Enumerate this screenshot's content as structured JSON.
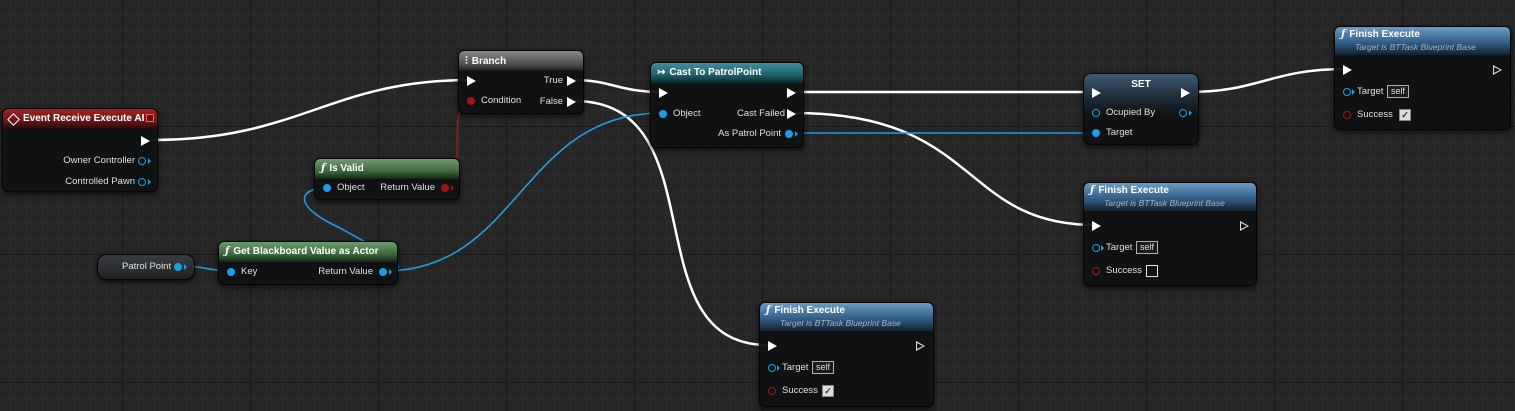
{
  "graph": {
    "event_node": {
      "title": "Event Receive Execute AI",
      "pins": {
        "owner_controller": "Owner Controller",
        "controlled_pawn": "Controlled Pawn"
      }
    },
    "branch_node": {
      "title": "Branch",
      "icon": "branch-icon",
      "pins": {
        "true": "True",
        "false": "False",
        "condition": "Condition"
      }
    },
    "is_valid_node": {
      "title": "Is Valid",
      "pins": {
        "object": "Object",
        "return_value": "Return Value"
      }
    },
    "get_blackboard_node": {
      "title": "Get Blackboard Value as Actor",
      "pins": {
        "key": "Key",
        "return_value": "Return Value"
      }
    },
    "patrol_point_var": {
      "label": "Patrol Point"
    },
    "cast_node": {
      "title": "Cast To PatrolPoint",
      "pins": {
        "object": "Object",
        "cast_failed": "Cast Failed",
        "as_patrol_point": "As Patrol Point"
      }
    },
    "set_node": {
      "title": "SET",
      "pins": {
        "ocupied_by": "Ocupied By",
        "target": "Target"
      }
    },
    "finish_execute_nodes": [
      {
        "title": "Finish Execute",
        "subtitle": "Target is BTTask Blueprint Base",
        "target_label": "Target",
        "target_value": "self",
        "success_label": "Success",
        "success_checked": true
      },
      {
        "title": "Finish Execute",
        "subtitle": "Target is BTTask Blueprint Base",
        "target_label": "Target",
        "target_value": "self",
        "success_label": "Success",
        "success_checked": false
      },
      {
        "title": "Finish Execute",
        "subtitle": "Target is BTTask Blueprint Base",
        "target_label": "Target",
        "target_value": "self",
        "success_label": "Success",
        "success_checked": true
      }
    ],
    "function_icon": "ƒ",
    "colors": {
      "exec_wire": "#ffffff",
      "object_wire": "#1a9ee6",
      "bool_wire": "#a31313",
      "event_header": "#a02222",
      "pure_header": "#5c8a5c",
      "cast_header": "#2f7d89",
      "function_header": "#4d7fab"
    }
  }
}
